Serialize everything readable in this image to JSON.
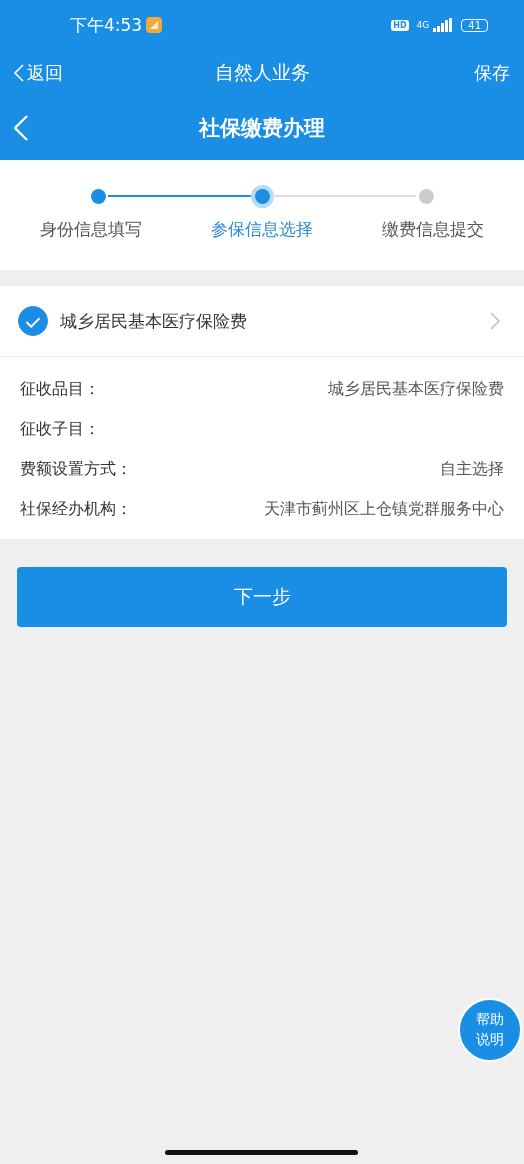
{
  "status_bar": {
    "time": "下午4:53",
    "hd": "HD",
    "network": "4G",
    "battery": "41"
  },
  "nav_bar": {
    "back": "返回",
    "title": "自然人业务",
    "action": "保存"
  },
  "page_title": "社保缴费办理",
  "steps": [
    {
      "label": "身份信息填写",
      "done": true,
      "selected": false
    },
    {
      "label": "参保信息选择",
      "done": false,
      "selected": true
    },
    {
      "label": "缴费信息提交",
      "done": false,
      "selected": false
    }
  ],
  "insurance": {
    "name": "城乡居民基本医疗保险费",
    "checked": true
  },
  "details": [
    {
      "label": "征收品目：",
      "value": "城乡居民基本医疗保险费"
    },
    {
      "label": "征收子目："
    },
    {
      "label": "费额设置方式：",
      "value": "自主选择"
    },
    {
      "label": "社保经办机构：",
      "value": "天津市蓟州区上仓镇党群服务中心"
    }
  ],
  "next_button": "下一步",
  "help_button": [
    "帮助",
    "说明"
  ]
}
